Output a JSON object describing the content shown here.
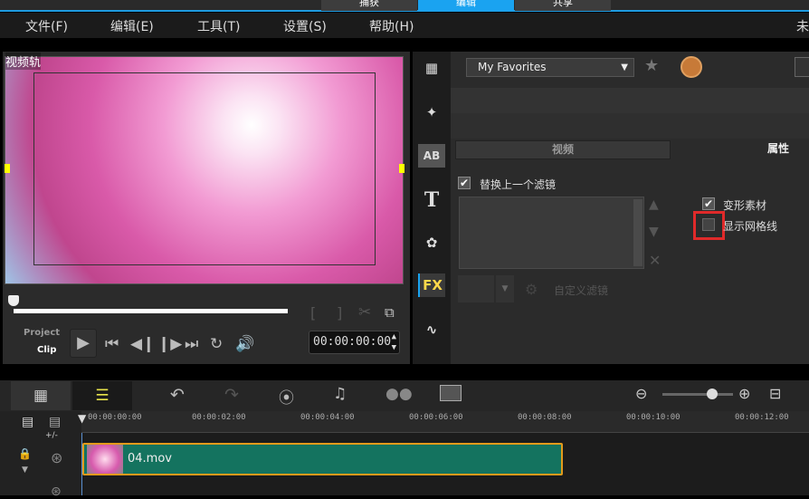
{
  "top_tabs": [
    {
      "label": "捕获"
    },
    {
      "label": "编辑",
      "active": true
    },
    {
      "label": "共享"
    }
  ],
  "menu": [
    "文件(F)",
    "编辑(E)",
    "工具(T)",
    "设置(S)",
    "帮助(H)"
  ],
  "menu_right": "未",
  "preview": {
    "track_label": "视频轨",
    "project_label": "Project",
    "clip_label": "Clip",
    "timecode": "00:00:00:00",
    "scrub_progress": 0
  },
  "side_icons": [
    "media-icon",
    "instant-project-icon",
    "transition-icon",
    "title-icon",
    "graphic-icon",
    "filter-fx-icon",
    "path-icon"
  ],
  "side_fx_label": "FX",
  "side_ab_label": "AB",
  "side_t_label": "T",
  "panel": {
    "favorites_select": "My Favorites",
    "tabs": [
      "视频",
      "属性"
    ],
    "replace_filter": {
      "label": "替换上一个滤镜",
      "checked": true
    },
    "distort_clip": {
      "label": "变形素材",
      "checked": true
    },
    "show_grid": {
      "label": "显示网格线",
      "checked": false
    },
    "custom_filter": "自定义滤镜"
  },
  "timeline": {
    "ruler": [
      "00:00:00:00",
      "00:00:02:00",
      "00:00:04:00",
      "00:00:06:00",
      "00:00:08:00",
      "00:00:10:00",
      "00:00:12:00"
    ],
    "zoom_level": 0.7,
    "clip": {
      "name": "04.mov"
    },
    "add_remove": "+/-"
  },
  "colors": {
    "accent": "#1aa3f0",
    "clip": "#14735f",
    "clip_border": "#e39a1b",
    "highlight": "#e02a2a"
  }
}
